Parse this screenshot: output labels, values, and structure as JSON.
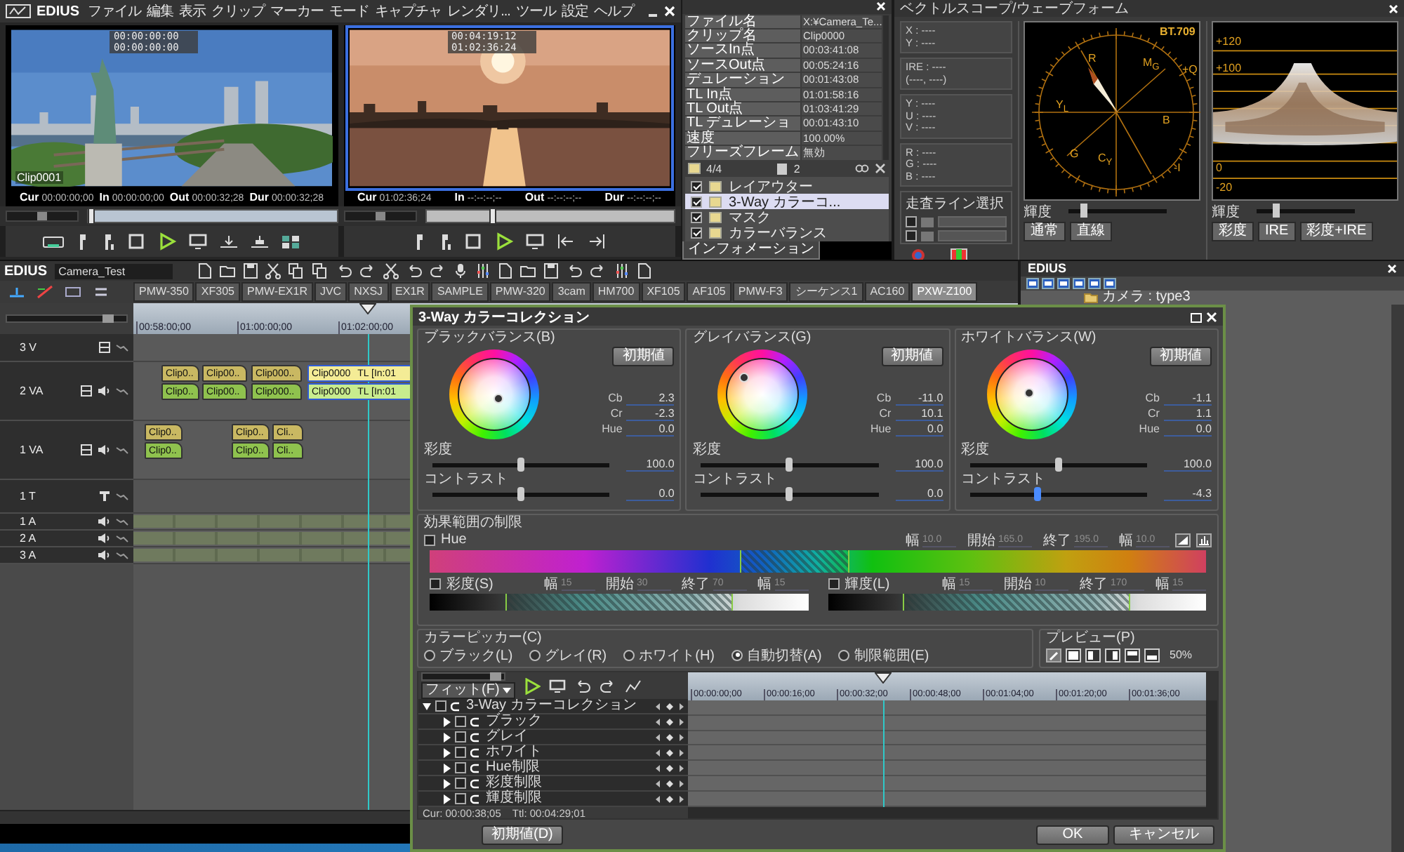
{
  "menu_bar": {
    "logo": "EDIUS",
    "items": [
      "ファイル",
      "編集",
      "表示",
      "クリップ",
      "マーカー",
      "モード",
      "キャプチャ",
      "レンダリ...",
      "ツール",
      "設定",
      "ヘルプ"
    ]
  },
  "monitors": [
    {
      "kind": "source",
      "active": false,
      "overlay": [
        "00:00:00:00",
        "00:00:00:00"
      ],
      "clip_label": "Clip0001",
      "timecodes": [
        {
          "label": "Cur",
          "value": "00:00:00;00"
        },
        {
          "label": "In",
          "value": "00:00:00;00"
        },
        {
          "label": "Out",
          "value": "00:00:32;28"
        },
        {
          "label": "Dur",
          "value": "00:00:32;28"
        }
      ],
      "level": 0.01,
      "jog": {
        "level": 0.5
      }
    },
    {
      "kind": "recorder",
      "active": true,
      "overlay": [
        "00:04:19:12",
        "01:02:36:24"
      ],
      "timecodes": [
        {
          "label": "Cur",
          "value": "01:02:36;24"
        },
        {
          "label": "In",
          "value": "--:--:--;--"
        },
        {
          "label": "Out",
          "value": "--:--:--;--"
        },
        {
          "label": "Dur",
          "value": "--:--:--;--"
        }
      ],
      "level": 0.27,
      "jog": {
        "level": 0.5
      }
    }
  ],
  "info_panel": {
    "rows": [
      {
        "label": "ファイル名",
        "value": "X:¥Camera_Te..."
      },
      {
        "label": "クリップ名",
        "value": "Clip0000"
      },
      {
        "label": "ソースIn点",
        "value": "00:03:41:08"
      },
      {
        "label": "ソースOut点",
        "value": "00:05:24:16"
      },
      {
        "label": "デュレーション",
        "value": "00:01:43:08"
      },
      {
        "label": "TL In点",
        "value": "01:01:58:16"
      },
      {
        "label": "TL Out点",
        "value": "01:03:41:29"
      },
      {
        "label": "TL デュレーショ",
        "value": "00:01:43:10"
      },
      {
        "label": "速度",
        "value": "100.00%"
      },
      {
        "label": "フリーズフレーム",
        "value": "無効"
      }
    ],
    "filter_count": "4/4",
    "layer_count": "2",
    "filters": [
      {
        "label": "レイアウター",
        "checked": true,
        "selected": false
      },
      {
        "label": "3-Way カラーコ...",
        "checked": true,
        "selected": true
      },
      {
        "label": "マスク",
        "checked": true,
        "selected": false
      },
      {
        "label": "カラーバランス",
        "checked": true,
        "selected": false
      }
    ],
    "tab": "インフォメーション"
  },
  "scope_panel": {
    "title": "ベクトルスコープ/ウェーブフォーム",
    "readouts": [
      [
        "X : ----",
        "Y : ----"
      ],
      [
        "IRE : ----",
        "(----, ----)"
      ],
      [
        "Y : ----",
        "U : ----",
        "V : ----"
      ],
      [
        "R : ----",
        "G : ----",
        "B : ----"
      ]
    ],
    "scan_line": {
      "title": "走査ライン選択",
      "lines": [
        {
          "checked": false
        },
        {
          "checked": false
        }
      ]
    },
    "vectorscope": {
      "standard": "BT.709",
      "targets": [
        "R",
        "M$_{G}$",
        "+Q",
        "Y$_{L}$",
        "B",
        "G",
        "C$_{Y}$",
        "-I"
      ],
      "brightness": {
        "label": "輝度",
        "level": 0.15
      },
      "buttons": [
        {
          "label": "通常",
          "selected": false
        },
        {
          "label": "直線",
          "selected": false
        }
      ]
    },
    "waveform": {
      "scale": [
        "+120",
        "+100",
        "0",
        "-20"
      ],
      "brightness": {
        "label": "輝度",
        "level": 0.2
      },
      "buttons": [
        {
          "label": "彩度",
          "selected": false
        },
        {
          "label": "IRE",
          "selected": false
        },
        {
          "label": "彩度+IRE",
          "selected": false
        }
      ]
    }
  },
  "timeline": {
    "logo": "EDIUS",
    "project": "Camera_Test",
    "sequences": [
      {
        "label": "PMW-350",
        "selected": false
      },
      {
        "label": "XF305",
        "selected": false
      },
      {
        "label": "PMW-EX1R",
        "selected": false
      },
      {
        "label": "JVC",
        "selected": false
      },
      {
        "label": "NXSJ",
        "selected": false
      },
      {
        "label": "EX1R",
        "selected": false
      },
      {
        "label": "SAMPLE",
        "selected": false
      },
      {
        "label": "PMW-320",
        "selected": false
      },
      {
        "label": "3cam",
        "selected": false
      },
      {
        "label": "HM700",
        "selected": false
      },
      {
        "label": "XF105",
        "selected": false
      },
      {
        "label": "AF105",
        "selected": false
      },
      {
        "label": "PMW-F3",
        "selected": false
      },
      {
        "label": "シーケンス1",
        "selected": false
      },
      {
        "label": "AC160",
        "selected": false
      },
      {
        "label": "PXW-Z100",
        "selected": true
      }
    ],
    "ruler": [
      "00:58:00;00",
      "01:00:00;00",
      "01:02:00;00"
    ],
    "playhead": {
      "level": 0.265
    },
    "zoom": {
      "level": 0.85
    },
    "tracks": [
      {
        "name": "3 V",
        "kind": "video"
      },
      {
        "name": "2 VA",
        "kind": "video_audio",
        "clips": [
          {
            "label": "Clip0..",
            "audio_label": "Clip0..",
            "selected": false
          },
          {
            "label": "Clip00..",
            "audio_label": "Clip00..",
            "selected": false
          },
          {
            "label": "Clip000..",
            "audio_label": "Clip000..",
            "selected": false
          },
          {
            "label": "Clip0000",
            "note": "TL [In:01",
            "audio_label": "Clip0000",
            "audio_note": "TL [In:01",
            "selected": true
          }
        ]
      },
      {
        "name": "1 VA",
        "kind": "video_audio",
        "clips": [
          {
            "label": "Clip0..",
            "audio_label": "Clip0..",
            "selected": false
          },
          {
            "label": "Clip0..",
            "audio_label": "Clip0..",
            "selected": false
          },
          {
            "label": "Cli..",
            "audio_label": "Cli..",
            "selected": false
          }
        ]
      },
      {
        "name": "1 T",
        "kind": "title"
      },
      {
        "name": "1 A",
        "kind": "audio"
      },
      {
        "name": "2 A",
        "kind": "audio"
      },
      {
        "name": "3 A",
        "kind": "audio"
      }
    ]
  },
  "bin": {
    "title": "EDIUS",
    "folder": "カメラ : type3"
  },
  "color_correction": {
    "title": "3-Way カラーコレクション",
    "balances": [
      {
        "title": "ブラックバランス(B)",
        "reset": "初期値",
        "params": [
          {
            "label": "Cb",
            "value": "2.3"
          },
          {
            "label": "Cr",
            "value": "-2.3"
          },
          {
            "label": "Hue",
            "value": "0.0"
          }
        ],
        "saturation": {
          "label": "彩度",
          "value": "100.0",
          "level": 0.5
        },
        "contrast": {
          "label": "コントラスト",
          "value": "0.0",
          "level": 0.5
        }
      },
      {
        "title": "グレイバランス(G)",
        "reset": "初期値",
        "params": [
          {
            "label": "Cb",
            "value": "-11.0"
          },
          {
            "label": "Cr",
            "value": "10.1"
          },
          {
            "label": "Hue",
            "value": "0.0"
          }
        ],
        "saturation": {
          "label": "彩度",
          "value": "100.0",
          "level": 0.5
        },
        "contrast": {
          "label": "コントラスト",
          "value": "0.0",
          "level": 0.5
        }
      },
      {
        "title": "ホワイトバランス(W)",
        "reset": "初期値",
        "params": [
          {
            "label": "Cb",
            "value": "-1.1"
          },
          {
            "label": "Cr",
            "value": "1.1"
          },
          {
            "label": "Hue",
            "value": "0.0"
          }
        ],
        "saturation": {
          "label": "彩度",
          "value": "100.0",
          "level": 0.5
        },
        "contrast": {
          "label": "コントラスト",
          "value": "-4.3",
          "level": 0.38
        }
      }
    ],
    "range": {
      "title": "効果範囲の制限",
      "hue": {
        "label": "Hue",
        "checked": false,
        "fields": [
          {
            "label": "幅",
            "value": "10.0"
          },
          {
            "label": "開始",
            "value": "165.0"
          },
          {
            "label": "終了",
            "value": "195.0"
          },
          {
            "label": "幅",
            "value": "10.0"
          }
        ]
      },
      "saturation": {
        "label": "彩度(S)",
        "checked": false,
        "fields": [
          {
            "label": "幅",
            "value": "15"
          },
          {
            "label": "開始",
            "value": "30"
          },
          {
            "label": "終了",
            "value": "70"
          },
          {
            "label": "幅",
            "value": "15"
          }
        ]
      },
      "luminance": {
        "label": "輝度(L)",
        "checked": false,
        "fields": [
          {
            "label": "幅",
            "value": "15"
          },
          {
            "label": "開始",
            "value": "10"
          },
          {
            "label": "終了",
            "value": "170"
          },
          {
            "label": "幅",
            "value": "15"
          }
        ]
      }
    },
    "picker": {
      "title": "カラーピッカー(C)",
      "options": [
        {
          "label": "ブラック(L)",
          "selected": false
        },
        {
          "label": "グレイ(R)",
          "selected": false
        },
        {
          "label": "ホワイト(H)",
          "selected": false
        },
        {
          "label": "自動切替(A)",
          "selected": true
        },
        {
          "label": "制限範囲(E)",
          "selected": false
        }
      ]
    },
    "preview": {
      "title": "プレビュー(P)",
      "zoom": "50%"
    },
    "keyframes": {
      "fit": "フィット(F)",
      "zoom": {
        "level": 0.9
      },
      "tree": [
        {
          "label": "3-Way カラーコレクション",
          "expanded": true,
          "checked": false,
          "children": [
            {
              "label": "ブラック",
              "expanded": false,
              "checked": false
            },
            {
              "label": "グレイ",
              "expanded": false,
              "checked": false
            },
            {
              "label": "ホワイト",
              "expanded": false,
              "checked": false
            },
            {
              "label": "Hue制限",
              "expanded": false,
              "checked": false
            },
            {
              "label": "彩度制限",
              "expanded": false,
              "checked": false
            },
            {
              "label": "輝度制限",
              "expanded": false,
              "checked": false
            }
          ]
        }
      ],
      "ruler": [
        "00:00:00;00",
        "00:00:16;00",
        "00:00:32;00",
        "00:00:48;00",
        "00:01:04;00",
        "00:01:20;00",
        "00:01:36;00"
      ],
      "playhead": {
        "level": 0.37
      },
      "cur": "Cur: 00:00:38;05",
      "total": "Ttl: 00:04:29;01"
    },
    "buttons": {
      "reset_all": "初期値(D)",
      "ok": "OK",
      "cancel": "キャンセル"
    }
  }
}
